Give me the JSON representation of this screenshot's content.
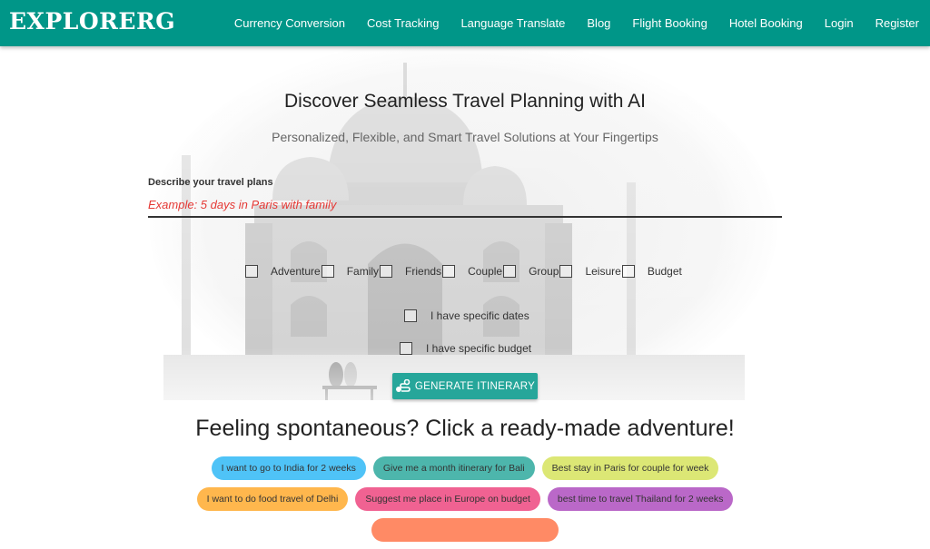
{
  "nav": {
    "brand": "EXPLORERG",
    "links": [
      {
        "label": "Currency Conversion"
      },
      {
        "label": "Cost Tracking"
      },
      {
        "label": "Language Translate"
      },
      {
        "label": "Blog"
      },
      {
        "label": "Flight Booking"
      },
      {
        "label": "Hotel Booking"
      },
      {
        "label": "Login"
      },
      {
        "label": "Register"
      }
    ],
    "color": "#009688"
  },
  "hero": {
    "title": "Discover Seamless Travel Planning with AI",
    "subtitle": "Personalized, Flexible, and Smart Travel Solutions at Your Fingertips",
    "background_icon": "taj-mahal-image"
  },
  "form": {
    "plan_label": "Describe your travel plans",
    "plan_placeholder": "Example: 5 days in Paris with family",
    "plan_value": "",
    "categories": [
      {
        "label": "Adventure",
        "checked": false
      },
      {
        "label": "Family",
        "checked": false
      },
      {
        "label": "Friends",
        "checked": false
      },
      {
        "label": "Couple",
        "checked": false
      },
      {
        "label": "Group",
        "checked": false
      },
      {
        "label": "Leisure",
        "checked": false
      },
      {
        "label": "Budget",
        "checked": false
      }
    ],
    "specific_dates_label": "I have specific dates",
    "specific_dates_checked": false,
    "specific_budget_label": "I have specific budget",
    "specific_budget_checked": false,
    "generate_label": "GENERATE ITINERARY",
    "generate_icon": "route-icon",
    "button_color": "#26a69a"
  },
  "spontaneous": {
    "title": "Feeling spontaneous? Click a ready-made adventure!",
    "chips": [
      {
        "label": "I want to go to India for 2 weeks",
        "color": "#4fc3f7"
      },
      {
        "label": "Give me a month itinerary for Bali",
        "color": "#4db6ac"
      },
      {
        "label": "Best stay in Paris for couple for week",
        "color": "#dce775"
      },
      {
        "label": "I want to do food travel of Delhi",
        "color": "#ffb74d"
      },
      {
        "label": "Suggest me place in Europe on budget",
        "color": "#f06292"
      },
      {
        "label": "best time to travel Thailand for 2 weeks",
        "color": "#ba68c8"
      },
      {
        "label": "",
        "color": "#ff8a65"
      }
    ]
  }
}
